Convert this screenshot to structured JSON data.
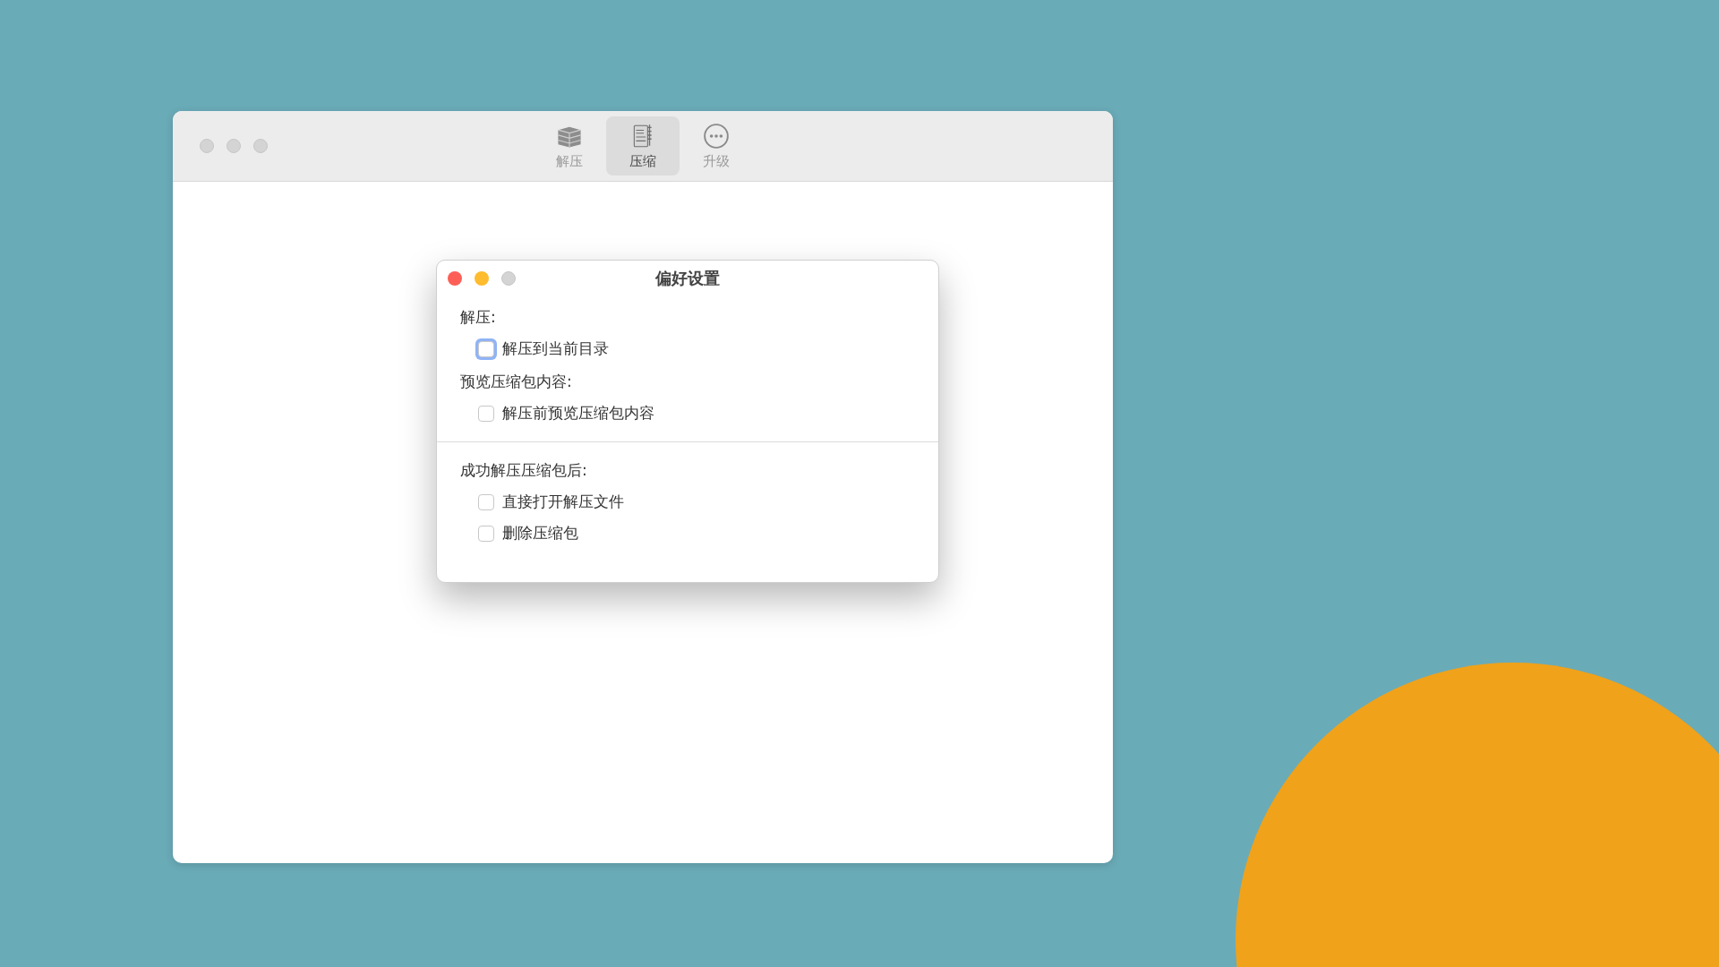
{
  "main_window": {
    "toolbar": [
      {
        "label": "解压",
        "kind": "extract",
        "selected": false
      },
      {
        "label": "压缩",
        "kind": "compress",
        "selected": true
      },
      {
        "label": "升级",
        "kind": "upgrade",
        "selected": false
      }
    ]
  },
  "dialog": {
    "title": "偏好设置",
    "sections": [
      {
        "label": "解压:",
        "divider_before": false,
        "options": [
          {
            "label": "解压到当前目录",
            "checked": false,
            "focused": true
          }
        ]
      },
      {
        "label": "预览压缩包内容:",
        "divider_before": false,
        "options": [
          {
            "label": "解压前预览压缩包内容",
            "checked": false,
            "focused": false
          }
        ]
      },
      {
        "label": "成功解压压缩包后:",
        "divider_before": true,
        "options": [
          {
            "label": "直接打开解压文件",
            "checked": false,
            "focused": false
          },
          {
            "label": "删除压缩包",
            "checked": false,
            "focused": false
          }
        ]
      }
    ]
  }
}
